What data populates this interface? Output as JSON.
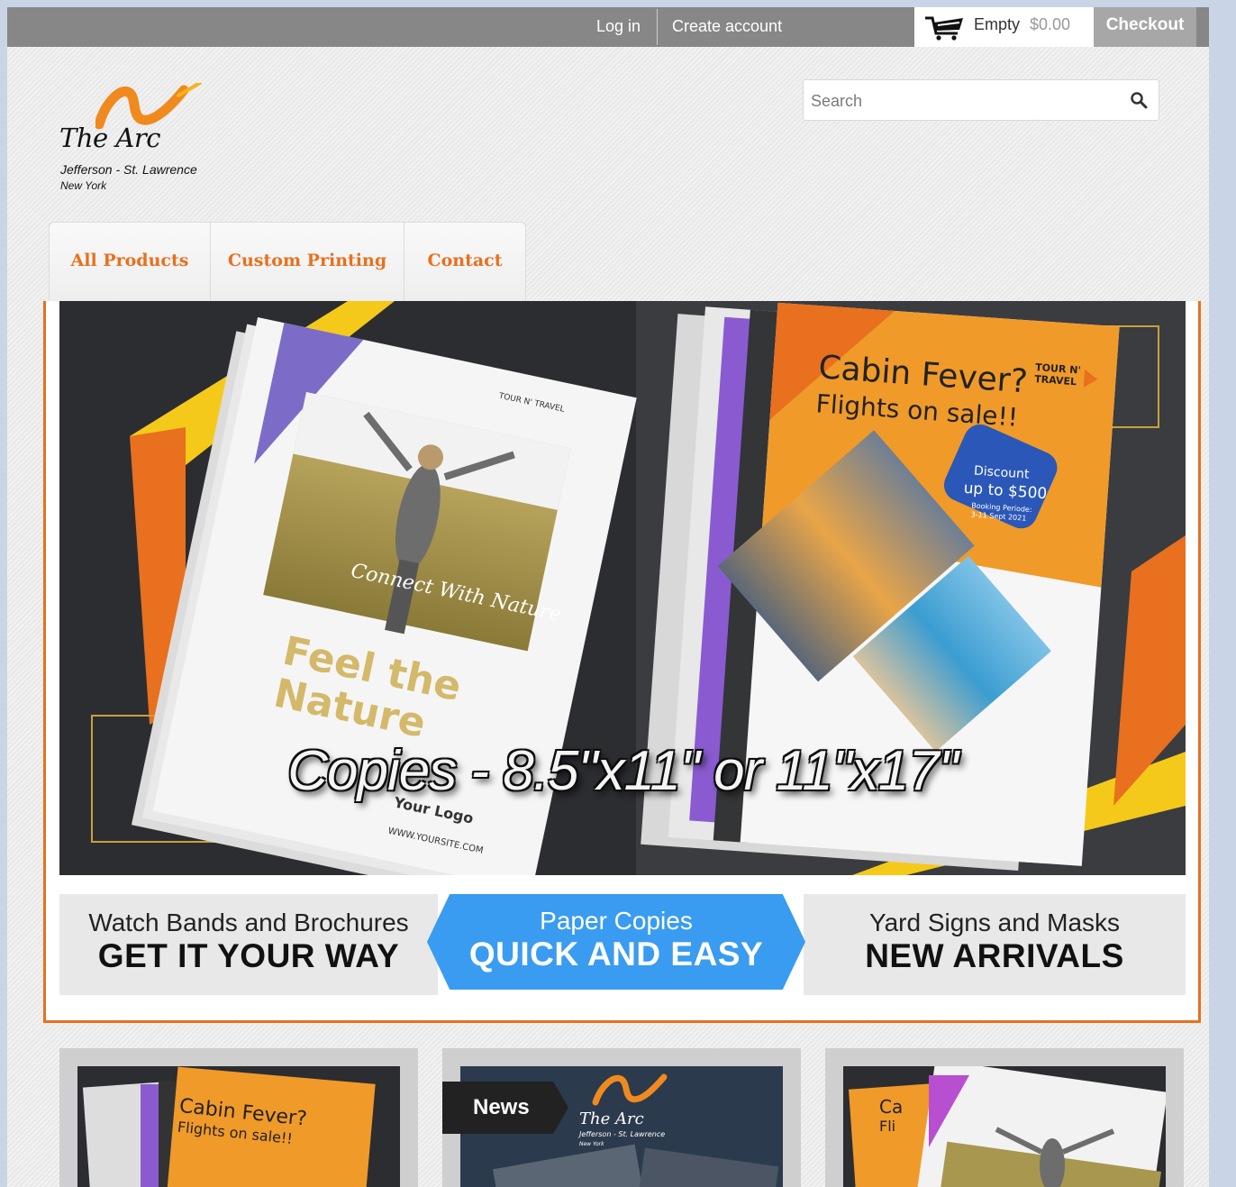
{
  "topbar": {
    "login": "Log in",
    "create_account": "Create account",
    "cart_status": "Empty",
    "cart_total": "$0.00",
    "checkout": "Checkout",
    "cart_icon": "shopping-cart-icon"
  },
  "logo": {
    "name": "The Arc",
    "subtitle": "Jefferson - St. Lawrence",
    "location": "New York"
  },
  "search": {
    "placeholder": "Search",
    "icon": "magnifier-icon"
  },
  "nav": {
    "items": [
      "All Products",
      "Custom Printing",
      "Contact"
    ]
  },
  "hero": {
    "caption": "Copies - 8.5\"x11\" or 11\"x17\"",
    "flyer_left": {
      "title_line1": "Feel the",
      "title_line2": "Nature",
      "script": "Connect With Nature",
      "brand": "TOUR N' TRAVEL",
      "logo": "Your Logo",
      "site": "WWW.YOURSITE.COM"
    },
    "flyer_right": {
      "title_line1": "Cabin Fever?",
      "title_line2": "Flights on sale!!",
      "brand_line1": "TOUR N'",
      "brand_line2": "TRAVEL",
      "discount_line1": "Discount",
      "discount_line2": "up to $500",
      "booking_line1": "Booking Periode:",
      "booking_line2": "3-11 Sept 2021"
    }
  },
  "promos": [
    {
      "small": "Watch Bands and Brochures",
      "big": "GET IT YOUR WAY"
    },
    {
      "small": "Paper Copies",
      "big": "QUICK AND EASY"
    },
    {
      "small": "Yard Signs and Masks",
      "big": "NEW ARRIVALS"
    }
  ],
  "cards": [
    {
      "title_line1": "Cabin Fever?",
      "title_line2": "Flights on sale!!"
    },
    {
      "tag": "News",
      "logo_name": "The Arc",
      "logo_sub": "Jefferson - St. Lawrence",
      "logo_loc": "New York"
    },
    {
      "title_line1": "Ca",
      "title_line2": "Fli"
    }
  ],
  "colors": {
    "accent": "#e8701f",
    "promo_highlight": "#3a9cf0",
    "topbar": "#878787"
  }
}
